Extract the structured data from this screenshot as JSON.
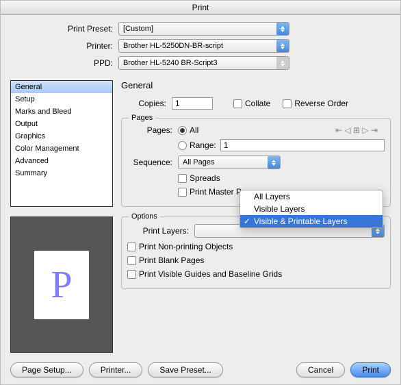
{
  "window_title": "Print",
  "presets": [
    {
      "label": "Print Preset:",
      "value": "[Custom]",
      "enabled": true
    },
    {
      "label": "Printer:",
      "value": "Brother HL-5250DN-BR-script",
      "enabled": true
    },
    {
      "label": "PPD:",
      "value": "Brother HL-5240 BR-Script3",
      "enabled": false
    }
  ],
  "categories": [
    "General",
    "Setup",
    "Marks and Bleed",
    "Output",
    "Graphics",
    "Color Management",
    "Advanced",
    "Summary"
  ],
  "selected_category": 0,
  "section_title": "General",
  "copies": {
    "label": "Copies:",
    "value": "1"
  },
  "collate_label": "Collate",
  "reverse_label": "Reverse Order",
  "pages_group": {
    "legend": "Pages",
    "pages_label": "Pages:",
    "all_label": "All",
    "range_label": "Range:",
    "range_value": "1",
    "sequence_label": "Sequence:",
    "sequence_value": "All Pages",
    "spreads_label": "Spreads",
    "master_label": "Print Master Pages"
  },
  "options_group": {
    "legend": "Options",
    "layers_label": "Print Layers:",
    "layers_menu": [
      "All Layers",
      "Visible Layers",
      "Visible & Printable Layers"
    ],
    "layers_selected": 2,
    "nonprint_label": "Print Non-printing Objects",
    "blank_label": "Print Blank Pages",
    "guides_label": "Print Visible Guides and Baseline Grids"
  },
  "preview_letter": "P",
  "buttons": {
    "page_setup": "Page Setup...",
    "printer": "Printer...",
    "save_preset": "Save Preset...",
    "cancel": "Cancel",
    "print": "Print"
  }
}
